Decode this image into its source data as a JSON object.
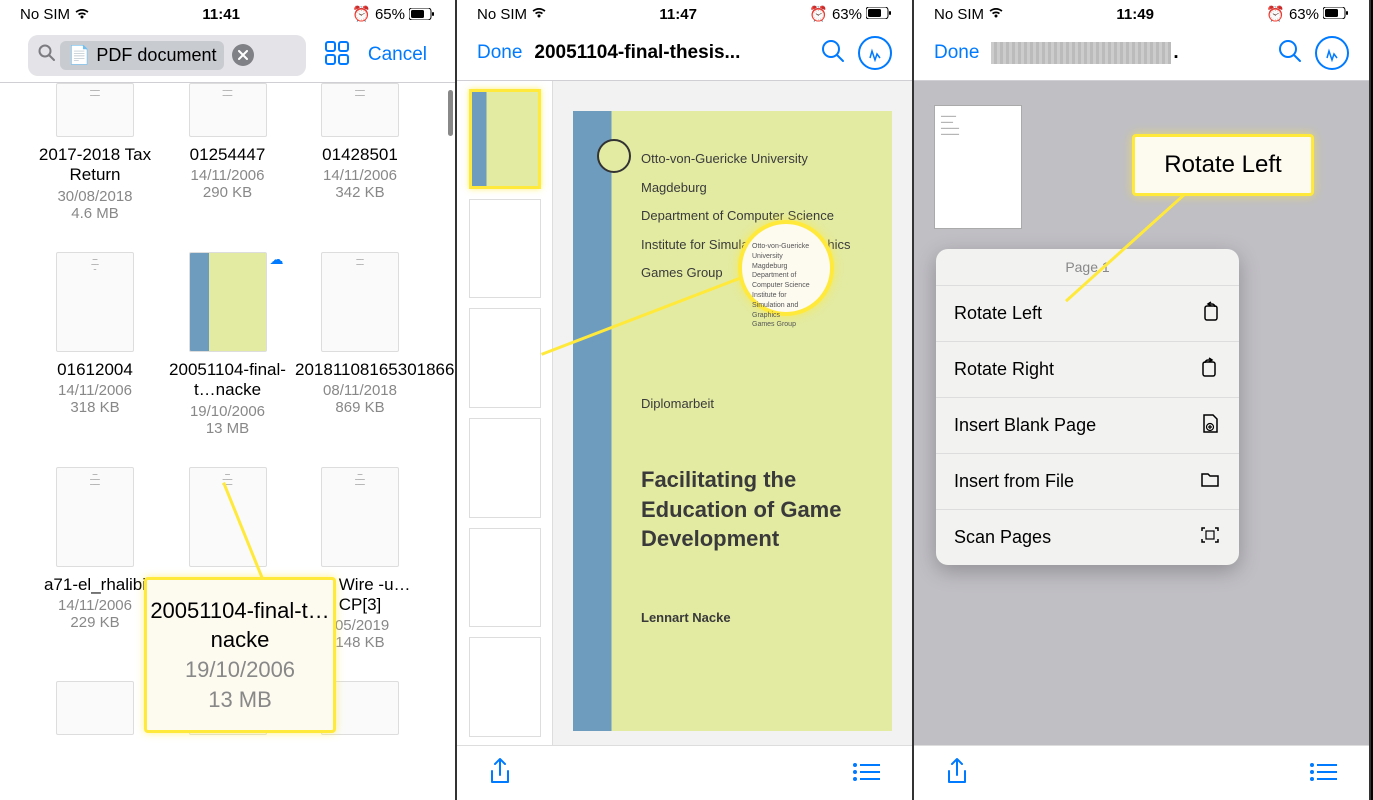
{
  "phone1": {
    "status": {
      "carrier": "No SIM",
      "time": "11:41",
      "battery": "65%"
    },
    "search": {
      "tag_label": "PDF document",
      "cancel": "Cancel"
    },
    "files": [
      {
        "name": "2017-2018 Tax Return",
        "date": "30/08/2018",
        "size": "4.6 MB"
      },
      {
        "name": "01254447",
        "date": "14/11/2006",
        "size": "290 KB"
      },
      {
        "name": "01428501",
        "date": "14/11/2006",
        "size": "342 KB"
      },
      {
        "name": "01612004",
        "date": "14/11/2006",
        "size": "318 KB"
      },
      {
        "name": "20051104-final-t…nacke",
        "date": "19/10/2006",
        "size": "13 MB"
      },
      {
        "name": "20181108165301866",
        "date": "08/11/2018",
        "size": "869 KB"
      },
      {
        "name": "a71-el_rhalibi",
        "date": "14/11/2006",
        "size": "229 KB"
      },
      {
        "name": "",
        "date": "",
        "size": ""
      },
      {
        "name": "CH Wire -u…CP[3]",
        "date": "/05/2019",
        "size": "148 KB"
      }
    ],
    "callout": {
      "name": "20051104-final-t…nacke",
      "date": "19/10/2006",
      "size": "13 MB"
    }
  },
  "phone2": {
    "status": {
      "carrier": "No SIM",
      "time": "11:47",
      "battery": "63%"
    },
    "done": "Done",
    "title": "20051104-final-thesis...",
    "thesis": {
      "uni": "Otto-von-Guericke University Magdeburg",
      "dept": "Department of Computer Science",
      "inst": "Institute for Simulation and Graphics",
      "group": "Games Group",
      "type": "Diplomarbeit",
      "title": "Facilitating the Education of Game Development",
      "author": "Lennart Nacke"
    }
  },
  "phone3": {
    "status": {
      "carrier": "No SIM",
      "time": "11:49",
      "battery": "63%"
    },
    "done": "Done",
    "title_suffix": ".",
    "menu": {
      "header": "Page 1",
      "rotate_left": "Rotate Left",
      "rotate_right": "Rotate Right",
      "insert_blank": "Insert Blank Page",
      "insert_file": "Insert from File",
      "scan": "Scan Pages"
    },
    "callout": "Rotate Left"
  },
  "colors": {
    "ios_blue": "#007aff",
    "yellow": "#ffe93b"
  }
}
